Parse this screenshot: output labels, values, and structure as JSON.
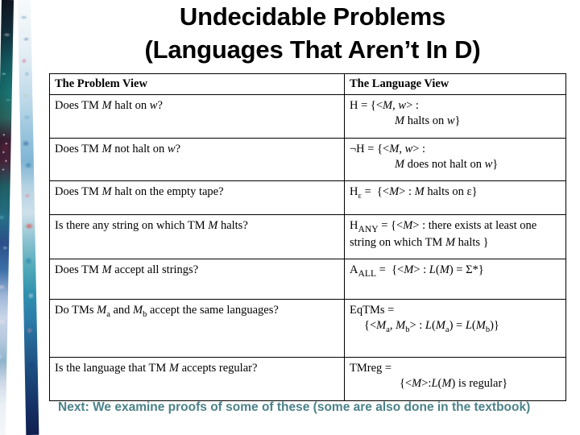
{
  "slide": {
    "title_line_1": "Undecidable Problems",
    "title_line_2": "(Languages That Aren’t In D)",
    "caption": "Next: We examine proofs of  some of these (some are also done in the textbook)",
    "caption_color": "#4b8289",
    "title_color": "#000000",
    "background_color": "#ffffff"
  },
  "decoration": {
    "left_strip_dark": "watercolor-floral-strip-dark",
    "left_strip_light": "watercolor-floral-strip-light"
  },
  "table": {
    "headers": {
      "problem_view": "The Problem View",
      "language_view": "The Language View"
    },
    "rows": [
      {
        "problem_plain": "Does TM M halt on w?",
        "language_plain": "H = {<M, w> : M halts on w}"
      },
      {
        "problem_plain": "Does TM M not halt on w?",
        "language_plain": "¬H = {<M, w> : M does not halt on w}"
      },
      {
        "problem_plain": "Does TM M halt on the empty tape?",
        "language_plain": "Hε = {<M> : M halts on ε}"
      },
      {
        "problem_plain": "Is there any string on which TM M halts?",
        "language_plain": "HANY = {<M> : there exists at least one string on which TM M halts }"
      },
      {
        "problem_plain": "Does TM M accept all strings?",
        "language_plain": "AALL = {<M> : L(M) = Σ*}"
      },
      {
        "problem_plain": "Do TMs Ma and Mb accept the same languages?",
        "language_plain": "EqTMs = {<Ma, Mb> : L(Ma) = L(Mb)}"
      },
      {
        "problem_plain": "Is the language that TM M accepts regular?",
        "language_plain": "TMreg = {<M>:L(M) is regular}"
      }
    ]
  }
}
